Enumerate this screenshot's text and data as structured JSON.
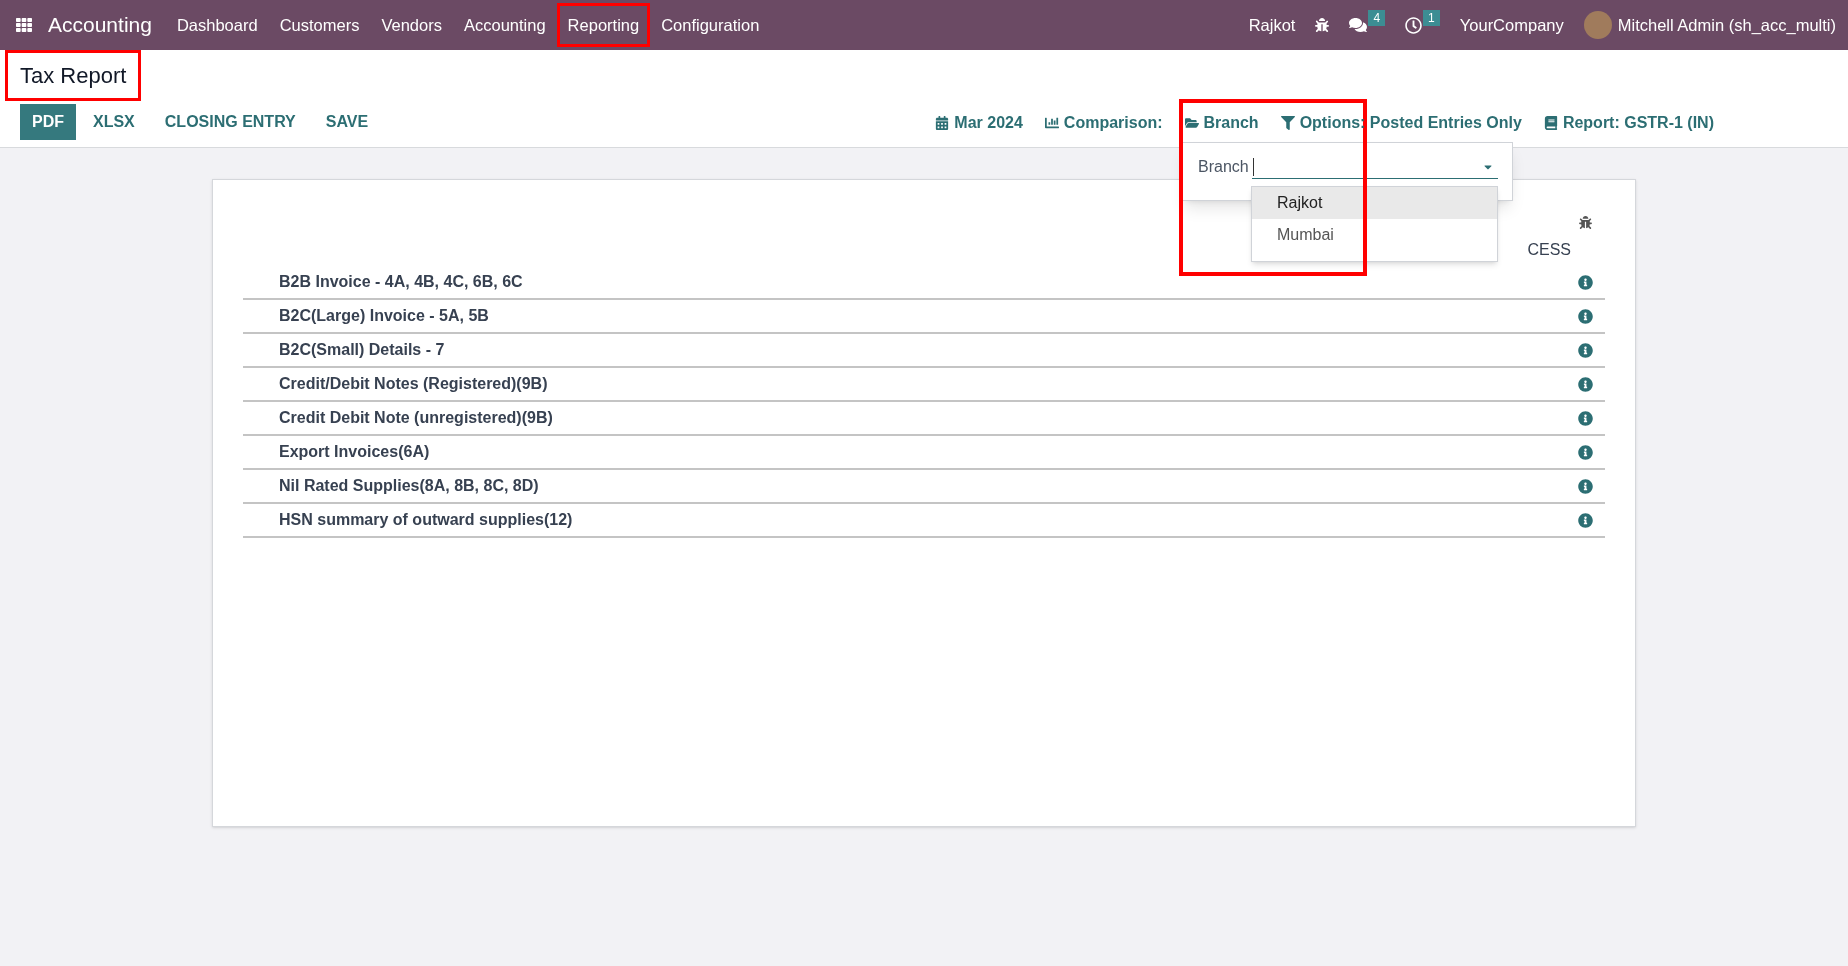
{
  "navbar": {
    "app_name": "Accounting",
    "menu": [
      {
        "label": "Dashboard",
        "highlighted": false
      },
      {
        "label": "Customers",
        "highlighted": false
      },
      {
        "label": "Vendors",
        "highlighted": false
      },
      {
        "label": "Accounting",
        "highlighted": false
      },
      {
        "label": "Reporting",
        "highlighted": true
      },
      {
        "label": "Configuration",
        "highlighted": false
      }
    ],
    "branch": "Rajkot",
    "messages_badge": "4",
    "activities_badge": "1",
    "company": "YourCompany",
    "user": "Mitchell Admin (sh_acc_multi)"
  },
  "page_title": {
    "text": "Tax Report",
    "highlighted": true
  },
  "actions": [
    {
      "label": "PDF",
      "kind": "primary"
    },
    {
      "label": "XLSX",
      "kind": "link"
    },
    {
      "label": "CLOSING ENTRY",
      "kind": "link"
    },
    {
      "label": "SAVE",
      "kind": "link"
    }
  ],
  "filters": [
    {
      "label": "Mar 2024",
      "kind": "date"
    },
    {
      "label": "Comparison:",
      "kind": "comparison"
    },
    {
      "label": "Branch",
      "kind": "branch"
    },
    {
      "label": "Options: Posted Entries Only",
      "kind": "options"
    },
    {
      "label": "Report: GSTR-1 (IN)",
      "kind": "report"
    }
  ],
  "branch_dropdown": {
    "label": "Branch",
    "highlighted": true,
    "options": [
      {
        "label": "Rajkot",
        "selected": true
      },
      {
        "label": "Mumbai",
        "selected": false
      }
    ]
  },
  "report": {
    "column_header": "CESS",
    "rows": [
      "B2B Invoice - 4A, 4B, 4C, 6B, 6C",
      "B2C(Large) Invoice - 5A, 5B",
      "B2C(Small) Details - 7",
      "Credit/Debit Notes (Registered)(9B)",
      "Credit Debit Note (unregistered)(9B)",
      "Export Invoices(6A)",
      "Nil Rated Supplies(8A, 8B, 8C, 8D)",
      "HSN summary of outward supplies(12)"
    ]
  }
}
